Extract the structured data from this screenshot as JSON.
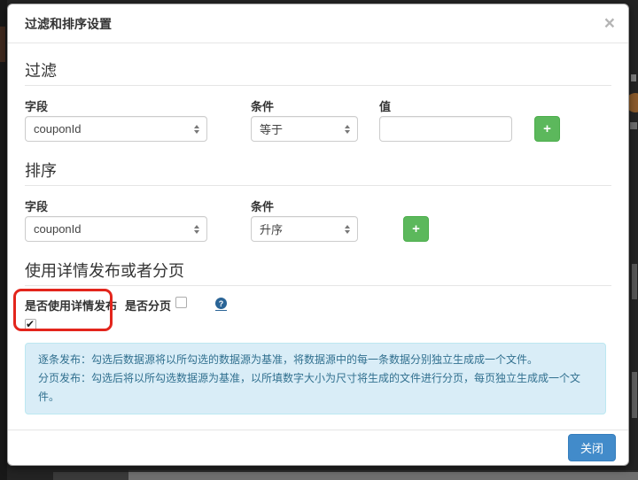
{
  "modal": {
    "title": "过滤和排序设置",
    "close_icon": "×",
    "sections": {
      "filter": {
        "heading": "过滤",
        "field_label": "字段",
        "field_value": "couponId",
        "condition_label": "条件",
        "condition_value": "等于",
        "value_label": "值",
        "value_input": "",
        "add_button": "+"
      },
      "sort": {
        "heading": "排序",
        "field_label": "字段",
        "field_value": "couponId",
        "condition_label": "条件",
        "condition_value": "升序",
        "add_button": "+"
      },
      "publish": {
        "heading": "使用详情发布或者分页",
        "detail_checkbox_label": "是否使用详情发布",
        "detail_checkbox_checked": true,
        "paging_checkbox_label": "是否分页",
        "paging_checkbox_checked": false,
        "help_icon": "?",
        "info_lines": [
          "逐条发布：勾选后数据源将以所勾选的数据源为基准，将数据源中的每一条数据分别独立生成成一个文件。",
          "分页发布：勾选后将以所勾选数据源为基准，以所填数字大小为尺寸将生成的文件进行分页，每页独立生成成一个文件。"
        ]
      }
    },
    "footer": {
      "close_button": "关闭"
    }
  },
  "colors": {
    "primary_button": "#428bca",
    "success_button": "#5cb85c",
    "info_bg": "#d9edf7",
    "info_border": "#bce8f1",
    "info_text": "#31708f",
    "annotation_red": "#e3251c",
    "divider": "#e5e5e5"
  }
}
